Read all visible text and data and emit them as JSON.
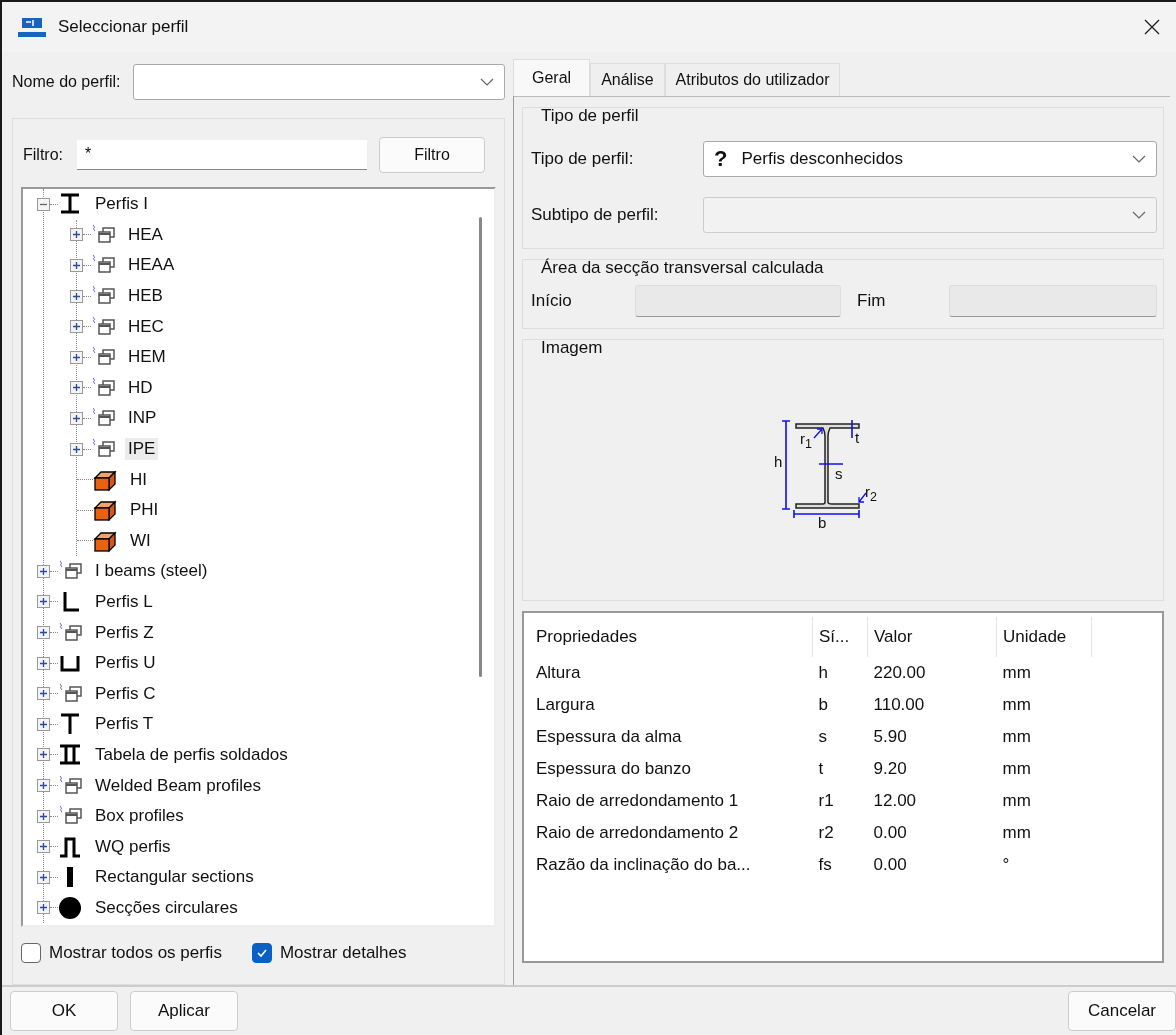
{
  "window": {
    "title": "Seleccionar perfil"
  },
  "profile_name": {
    "label": "Nome do perfil:"
  },
  "filter": {
    "label": "Filtro:",
    "value": "*",
    "button": "Filtro"
  },
  "tree": [
    {
      "label": "Perfis I",
      "kind": "i-beam",
      "expanded": true,
      "selected": false,
      "children": [
        {
          "label": "HEA",
          "kind": "table",
          "expanded": false,
          "selected": false
        },
        {
          "label": "HEAA",
          "kind": "table",
          "expanded": false,
          "selected": false
        },
        {
          "label": "HEB",
          "kind": "table",
          "expanded": false,
          "selected": false
        },
        {
          "label": "HEC",
          "kind": "table",
          "expanded": false,
          "selected": false
        },
        {
          "label": "HEM",
          "kind": "table",
          "expanded": false,
          "selected": false
        },
        {
          "label": "HD",
          "kind": "table",
          "expanded": false,
          "selected": false
        },
        {
          "label": "INP",
          "kind": "table",
          "expanded": false,
          "selected": false
        },
        {
          "label": "IPE",
          "kind": "table",
          "expanded": false,
          "selected": true
        },
        {
          "label": "HI",
          "kind": "block",
          "selected": false
        },
        {
          "label": "PHI",
          "kind": "block",
          "selected": false
        },
        {
          "label": "WI",
          "kind": "block",
          "selected": false
        }
      ]
    },
    {
      "label": "I beams (steel)",
      "kind": "table",
      "expanded": false,
      "selected": false
    },
    {
      "label": "Perfis L",
      "kind": "angle",
      "expanded": false,
      "selected": false
    },
    {
      "label": "Perfis Z",
      "kind": "table",
      "expanded": false,
      "selected": false
    },
    {
      "label": "Perfis U",
      "kind": "channel",
      "expanded": false,
      "selected": false
    },
    {
      "label": "Perfis C",
      "kind": "table",
      "expanded": false,
      "selected": false
    },
    {
      "label": "Perfis T",
      "kind": "tee",
      "expanded": false,
      "selected": false
    },
    {
      "label": "Tabela de perfis soldados",
      "kind": "double-tee",
      "expanded": false,
      "selected": false
    },
    {
      "label": "Welded Beam profiles",
      "kind": "table",
      "expanded": false,
      "selected": false
    },
    {
      "label": "Box profiles",
      "kind": "table",
      "expanded": false,
      "selected": false
    },
    {
      "label": "WQ perfis",
      "kind": "hat",
      "expanded": false,
      "selected": false
    },
    {
      "label": "Rectangular sections",
      "kind": "bar",
      "expanded": false,
      "selected": false
    },
    {
      "label": "Secções circulares",
      "kind": "circle",
      "expanded": false,
      "selected": false
    }
  ],
  "options": [
    {
      "label": "Mostrar todos os perfis",
      "checked": false
    },
    {
      "label": "Mostrar detalhes",
      "checked": true
    }
  ],
  "tabs": [
    {
      "label": "Geral",
      "selected": true
    },
    {
      "label": "Análise",
      "selected": false
    },
    {
      "label": "Atributos do utilizador",
      "selected": false
    }
  ],
  "profile_type": {
    "title": "Tipo de perfil",
    "type_label": "Tipo de perfil:",
    "type_icon": "?",
    "type_value": "Perfis desconhecidos",
    "subtype_label": "Subtipo de perfil:"
  },
  "area": {
    "title": "Área da secção transversal calculada",
    "start_label": "Início",
    "end_label": "Fim"
  },
  "image": {
    "title": "Imagem",
    "labels": [
      "h",
      "t",
      "r$_{1}$",
      "s",
      "r$_{2}$",
      "b"
    ]
  },
  "properties": {
    "columns": [
      "Propriedades",
      "Sí...",
      "Valor",
      "Unidade"
    ],
    "rows": [
      [
        "Altura",
        "h",
        "220.00",
        "mm"
      ],
      [
        "Largura",
        "b",
        "110.00",
        "mm"
      ],
      [
        "Espessura da alma",
        "s",
        "5.90",
        "mm"
      ],
      [
        "Espessura do banzo",
        "t",
        "9.20",
        "mm"
      ],
      [
        "Raio de arredondamento 1",
        "r1",
        "12.00",
        "mm"
      ],
      [
        "Raio de arredondamento 2",
        "r2",
        "0.00",
        "mm"
      ],
      [
        "Razão da inclinação do ba...",
        "fs",
        "0.00",
        "°"
      ]
    ]
  },
  "buttons": [
    "OK",
    "Aplicar",
    "Cancelar"
  ]
}
